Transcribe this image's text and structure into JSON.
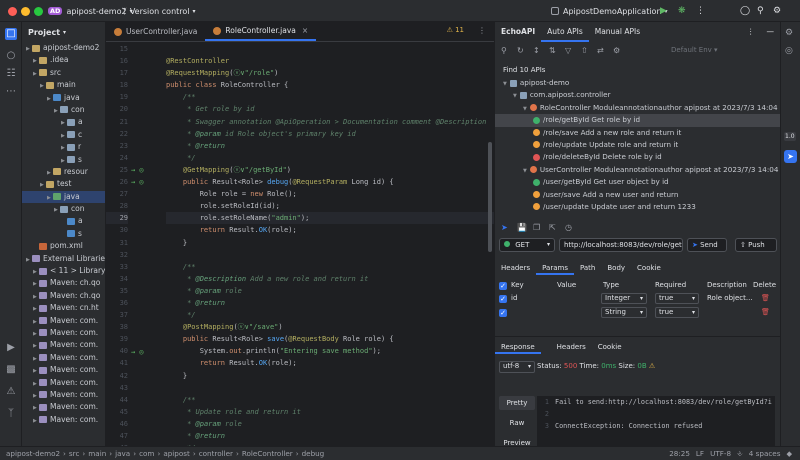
{
  "titlebar": {
    "project_badge": "AD",
    "project_name": "apipost-demo2",
    "vcs": "Version control",
    "run_config": "ApipostDemoApplication"
  },
  "project_panel": {
    "title": "Project",
    "tree": [
      {
        "label": "apipost-demo2",
        "depth": 0,
        "kind": "folder"
      },
      {
        "label": ".idea",
        "depth": 1,
        "kind": "folder"
      },
      {
        "label": "src",
        "depth": 1,
        "kind": "folder"
      },
      {
        "label": "main",
        "depth": 2,
        "kind": "folder"
      },
      {
        "label": "java",
        "depth": 3,
        "kind": "src"
      },
      {
        "label": "con",
        "depth": 4,
        "kind": "pkg"
      },
      {
        "label": "a",
        "depth": 5,
        "kind": "pkg"
      },
      {
        "label": "c",
        "depth": 5,
        "kind": "pkg"
      },
      {
        "label": "r",
        "depth": 5,
        "kind": "pkg"
      },
      {
        "label": "s",
        "depth": 5,
        "kind": "pkg"
      },
      {
        "label": "resour",
        "depth": 3,
        "kind": "folder"
      },
      {
        "label": "test",
        "depth": 2,
        "kind": "folder"
      },
      {
        "label": "java",
        "depth": 3,
        "kind": "test",
        "selected": true
      },
      {
        "label": "con",
        "depth": 4,
        "kind": "pkg"
      },
      {
        "label": "a",
        "depth": 5,
        "kind": "cls"
      },
      {
        "label": "s",
        "depth": 5,
        "kind": "cls"
      },
      {
        "label": "pom.xml",
        "depth": 1,
        "kind": "file"
      },
      {
        "label": "External Librarie",
        "depth": 0,
        "kind": "lib"
      },
      {
        "label": "< 11 >  Library",
        "depth": 1,
        "kind": "lib"
      },
      {
        "label": "Maven: ch.qo",
        "depth": 1,
        "kind": "lib"
      },
      {
        "label": "Maven: ch.qo",
        "depth": 1,
        "kind": "lib"
      },
      {
        "label": "Maven: cn.ht",
        "depth": 1,
        "kind": "lib"
      },
      {
        "label": "Maven: com.",
        "depth": 1,
        "kind": "lib"
      },
      {
        "label": "Maven: com.",
        "depth": 1,
        "kind": "lib"
      },
      {
        "label": "Maven: com.",
        "depth": 1,
        "kind": "lib"
      },
      {
        "label": "Maven: com.",
        "depth": 1,
        "kind": "lib"
      },
      {
        "label": "Maven: com.",
        "depth": 1,
        "kind": "lib"
      },
      {
        "label": "Maven: com.",
        "depth": 1,
        "kind": "lib"
      },
      {
        "label": "Maven: com.",
        "depth": 1,
        "kind": "lib"
      },
      {
        "label": "Maven: com.",
        "depth": 1,
        "kind": "lib"
      },
      {
        "label": "Maven: com.",
        "depth": 1,
        "kind": "lib"
      }
    ]
  },
  "editor": {
    "tabs": [
      {
        "label": "UserController.java",
        "active": false
      },
      {
        "label": "RoleController.java",
        "active": true
      }
    ],
    "inspection": "⚠ 11",
    "current_line": 29,
    "lines": [
      {
        "n": 15,
        "html": ""
      },
      {
        "n": 16,
        "html": "<span class='an'>@RestController</span>"
      },
      {
        "n": 17,
        "html": "<span class='an'>@RequestMapping</span>(<span class='str'>ⓥ∨\"/role\"</span>)"
      },
      {
        "n": 18,
        "html": "<span class='kw'>public class</span> RoleController {"
      },
      {
        "n": 19,
        "html": "    <span class='cm'>/**</span>"
      },
      {
        "n": 20,
        "html": "     <span class='cm'>* Get role by id</span>"
      },
      {
        "n": 21,
        "html": "     <span class='cm'>* Swagger annotation @ApiOperation &gt; Documentation comment @Description</span>"
      },
      {
        "n": 22,
        "html": "     <span class='cm'>* <span class='tag'>@param</span> id Role object's primary key id</span>"
      },
      {
        "n": 23,
        "html": "     <span class='cm'>* <span class='tag'>@return</span></span>"
      },
      {
        "n": 24,
        "html": "     <span class='cm'>*/</span>"
      },
      {
        "n": 25,
        "html": "    <span class='an'>@GetMapping</span>(<span class='str'>ⓥ∨\"/getById\"</span>)"
      },
      {
        "n": 26,
        "html": "    <span class='kw'>public</span> Result&lt;Role&gt; <span class='fn'>debug</span>(<span class='an'>@RequestParam</span> Long id) {"
      },
      {
        "n": 27,
        "html": "        Role role = <span class='kw'>new</span> Role();"
      },
      {
        "n": 28,
        "html": "        role.setRoleId(id);"
      },
      {
        "n": 29,
        "html": "        role.setRoleName(<span class='str'>\"admin\"</span>);"
      },
      {
        "n": 30,
        "html": "        <span class='kw'>return</span> Result.<span class='fn'>OK</span>(role);"
      },
      {
        "n": 31,
        "html": "    }"
      },
      {
        "n": 32,
        "html": ""
      },
      {
        "n": 33,
        "html": "    <span class='cm'>/**</span>"
      },
      {
        "n": 34,
        "html": "     <span class='cm'>* <span class='tag'>@Description</span> Add a new role and return it</span>"
      },
      {
        "n": 35,
        "html": "     <span class='cm'>* <span class='tag'>@param</span> role</span>"
      },
      {
        "n": 36,
        "html": "     <span class='cm'>* <span class='tag'>@return</span></span>"
      },
      {
        "n": 37,
        "html": "     <span class='cm'>*/</span>"
      },
      {
        "n": 38,
        "html": "    <span class='an'>@PostMapping</span>(<span class='str'>ⓥ∨\"/save\"</span>)"
      },
      {
        "n": 39,
        "html": "    <span class='kw'>public</span> Result&lt;Role&gt; <span class='fn'>save</span>(<span class='an'>@RequestBody</span> Role role) {"
      },
      {
        "n": 40,
        "html": "        System.<span class='kw'>out</span>.println(<span class='str'>\"Entering save method\"</span>);"
      },
      {
        "n": 41,
        "html": "        <span class='kw'>return</span> Result.<span class='fn'>OK</span>(role);"
      },
      {
        "n": 42,
        "html": "    }"
      },
      {
        "n": 43,
        "html": ""
      },
      {
        "n": 44,
        "html": "    <span class='cm'>/**</span>"
      },
      {
        "n": 45,
        "html": "     <span class='cm'>* Update role and return it</span>"
      },
      {
        "n": 46,
        "html": "     <span class='cm'>* <span class='tag'>@param</span> role</span>"
      },
      {
        "n": 47,
        "html": "     <span class='cm'>* <span class='tag'>@return</span></span>"
      },
      {
        "n": 48,
        "html": "     <span class='cm'>*/</span>"
      }
    ]
  },
  "echo": {
    "tabs": [
      "EchoAPI",
      "Auto APIs",
      "Manual APIs"
    ],
    "env": "Default Env",
    "found": "Find 10 APIs",
    "tree": [
      {
        "label": "apipost-demo",
        "depth": 0,
        "kind": "root"
      },
      {
        "label": "com.apipost.controller",
        "depth": 1,
        "kind": "pkg"
      },
      {
        "label": "RoleController  Moduleannotationauthor apipost at 2023/7/3 14:04",
        "depth": 2,
        "kind": "ctrl"
      },
      {
        "label": "/role/getById  Get role by id",
        "depth": 3,
        "kind": "api",
        "selected": true
      },
      {
        "label": "/role/save  Add a new role and return it",
        "depth": 3,
        "kind": "api"
      },
      {
        "label": "/role/update  Update role and return it",
        "depth": 3,
        "kind": "api"
      },
      {
        "label": "/role/deleteById  Delete role by id",
        "depth": 3,
        "kind": "api"
      },
      {
        "label": "UserController  Moduleannotationauthor apipost at 2023/7/3 14:04",
        "depth": 2,
        "kind": "ctrl"
      },
      {
        "label": "/user/getById  Get user object by id",
        "depth": 3,
        "kind": "api"
      },
      {
        "label": "/user/save  Add a new user and return",
        "depth": 3,
        "kind": "api"
      },
      {
        "label": "/user/update  Update user and return 1233",
        "depth": 3,
        "kind": "api"
      }
    ],
    "method": "GET",
    "url": "http://localhost:8083/dev/role/getById",
    "send": "Send",
    "push": "Push",
    "req_tabs": [
      "Headers",
      "Params",
      "Path",
      "Body",
      "Cookie"
    ],
    "param_headers": [
      "Key",
      "Value",
      "Type",
      "Required",
      "Description",
      "Delete"
    ],
    "params": [
      {
        "key": "id",
        "value": "",
        "type": "Integer",
        "required": "true",
        "description": "Role object..."
      },
      {
        "key": "",
        "value": "",
        "type": "String",
        "required": "true",
        "description": ""
      }
    ],
    "resp_tabs": [
      "Response",
      "Headers",
      "Cookie"
    ],
    "encoding": "utf-8",
    "status_label": "Status:",
    "status_value": "500",
    "time_label": "Time:",
    "time_value": "0ms",
    "size_label": "Size:",
    "size_value": "0B",
    "view_buttons": [
      "Pretty",
      "Raw",
      "Preview"
    ],
    "response_lines": [
      {
        "n": "1",
        "text": "Fail to send:http://localhost:8083/dev/role/getById?i"
      },
      {
        "n": "2",
        "text": ""
      },
      {
        "n": "3",
        "text": "ConnectException: Connection refused"
      }
    ]
  },
  "statusbar": {
    "path": [
      "apipost-demo2",
      "src",
      "main",
      "java",
      "com",
      "apipost",
      "controller",
      "RoleController",
      "debug"
    ],
    "position": "28:25",
    "line_sep": "LF",
    "encoding": "UTF-8",
    "indent": "4 spaces"
  },
  "colors": {
    "accent": "#3574f0",
    "get": "#3fb16b",
    "post": "#f0a03c",
    "delete": "#e05555",
    "error": "#e05555"
  }
}
